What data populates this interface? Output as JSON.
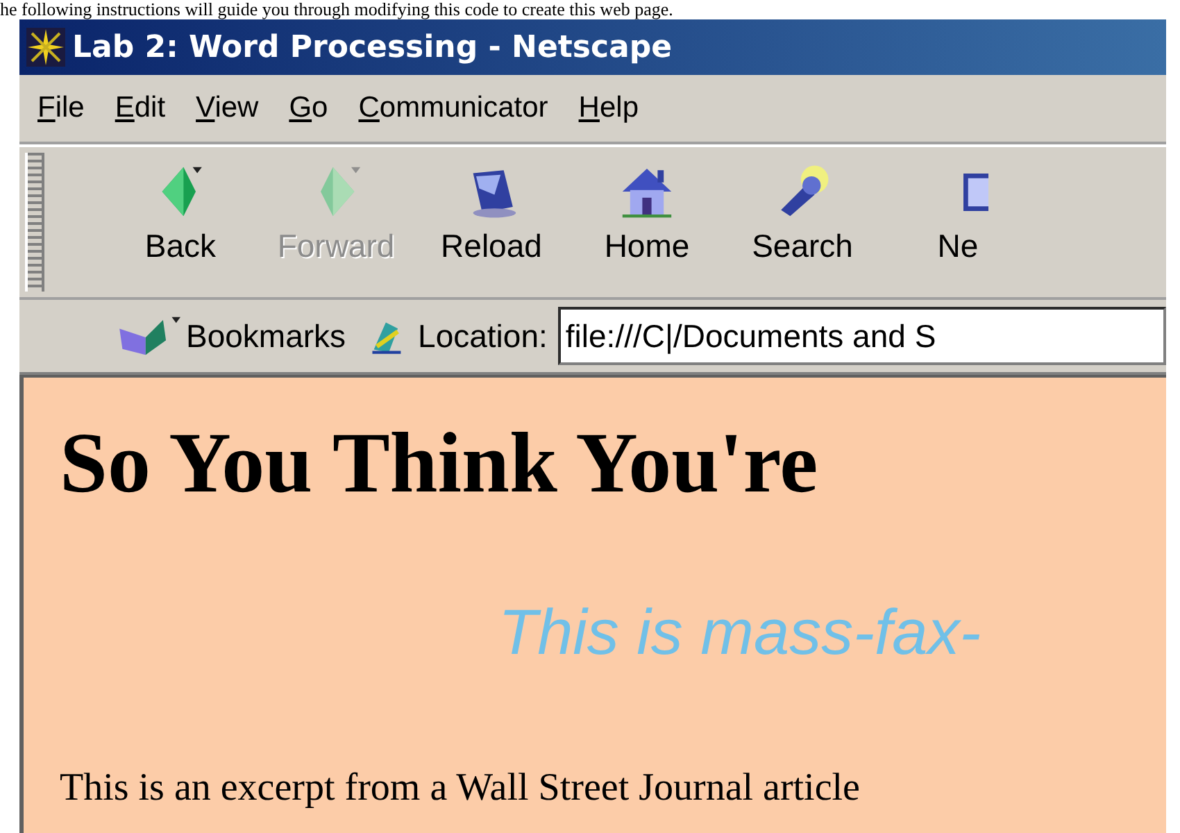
{
  "caption": "he following instructions will guide you through modifying this code to create this web page.",
  "window": {
    "title": "Lab 2: Word Processing - Netscape"
  },
  "menu": [
    {
      "label": "File"
    },
    {
      "label": "Edit"
    },
    {
      "label": "View"
    },
    {
      "label": "Go"
    },
    {
      "label": "Communicator"
    },
    {
      "label": "Help"
    }
  ],
  "toolbar": [
    {
      "label": "Back",
      "disabled": false
    },
    {
      "label": "Forward",
      "disabled": true
    },
    {
      "label": "Reload",
      "disabled": false
    },
    {
      "label": "Home",
      "disabled": false
    },
    {
      "label": "Search",
      "disabled": false
    },
    {
      "label": "Ne",
      "disabled": false
    }
  ],
  "location_bar": {
    "bookmarks": "Bookmarks",
    "label": "Location:",
    "value": "file:///C|/Documents and S"
  },
  "page": {
    "heading": "So You Think You're",
    "subtitle": "This is mass-fax-",
    "paragraph": "This is an excerpt from a Wall Street Journal article"
  }
}
